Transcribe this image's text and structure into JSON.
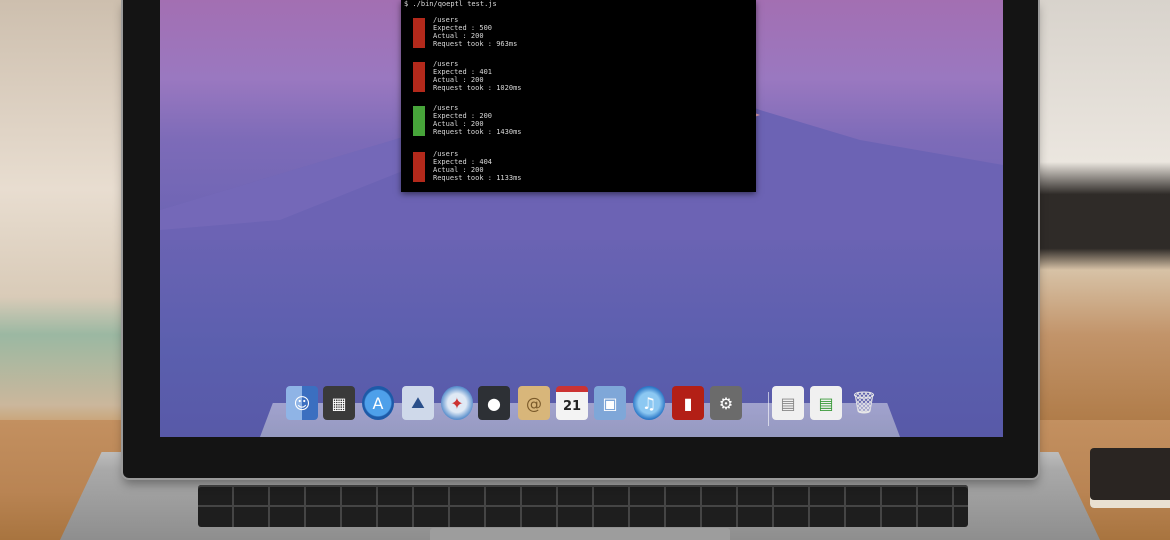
{
  "terminal": {
    "command": "$ ./bin/qoeptl test.js",
    "results": [
      {
        "path": "/users",
        "expected": "Expected : 500",
        "actual": "Actual : 200",
        "took": "Request took : 963ms",
        "status": "fail"
      },
      {
        "path": "/users",
        "expected": "Expected : 401",
        "actual": "Actual : 200",
        "took": "Request took : 1020ms",
        "status": "fail"
      },
      {
        "path": "/users",
        "expected": "Expected : 200",
        "actual": "Actual : 200",
        "took": "Request took : 1430ms",
        "status": "pass"
      },
      {
        "path": "/users",
        "expected": "Expected : 404",
        "actual": "Actual : 200",
        "took": "Request took : 1133ms",
        "status": "fail"
      }
    ]
  },
  "dock": {
    "calendar_day": "21",
    "icons": [
      "finder-icon",
      "dashboard-icon",
      "app-store-icon",
      "preview-icon",
      "safari-icon",
      "facetime-icon",
      "contacts-icon",
      "calendar-icon",
      "iphoto-icon",
      "itunes-icon",
      "photo-booth-icon",
      "system-preferences-icon",
      "document-icon",
      "document-alt-icon",
      "trash-icon"
    ]
  },
  "colors": {
    "fail": "#b3291b",
    "pass": "#47a43a"
  }
}
